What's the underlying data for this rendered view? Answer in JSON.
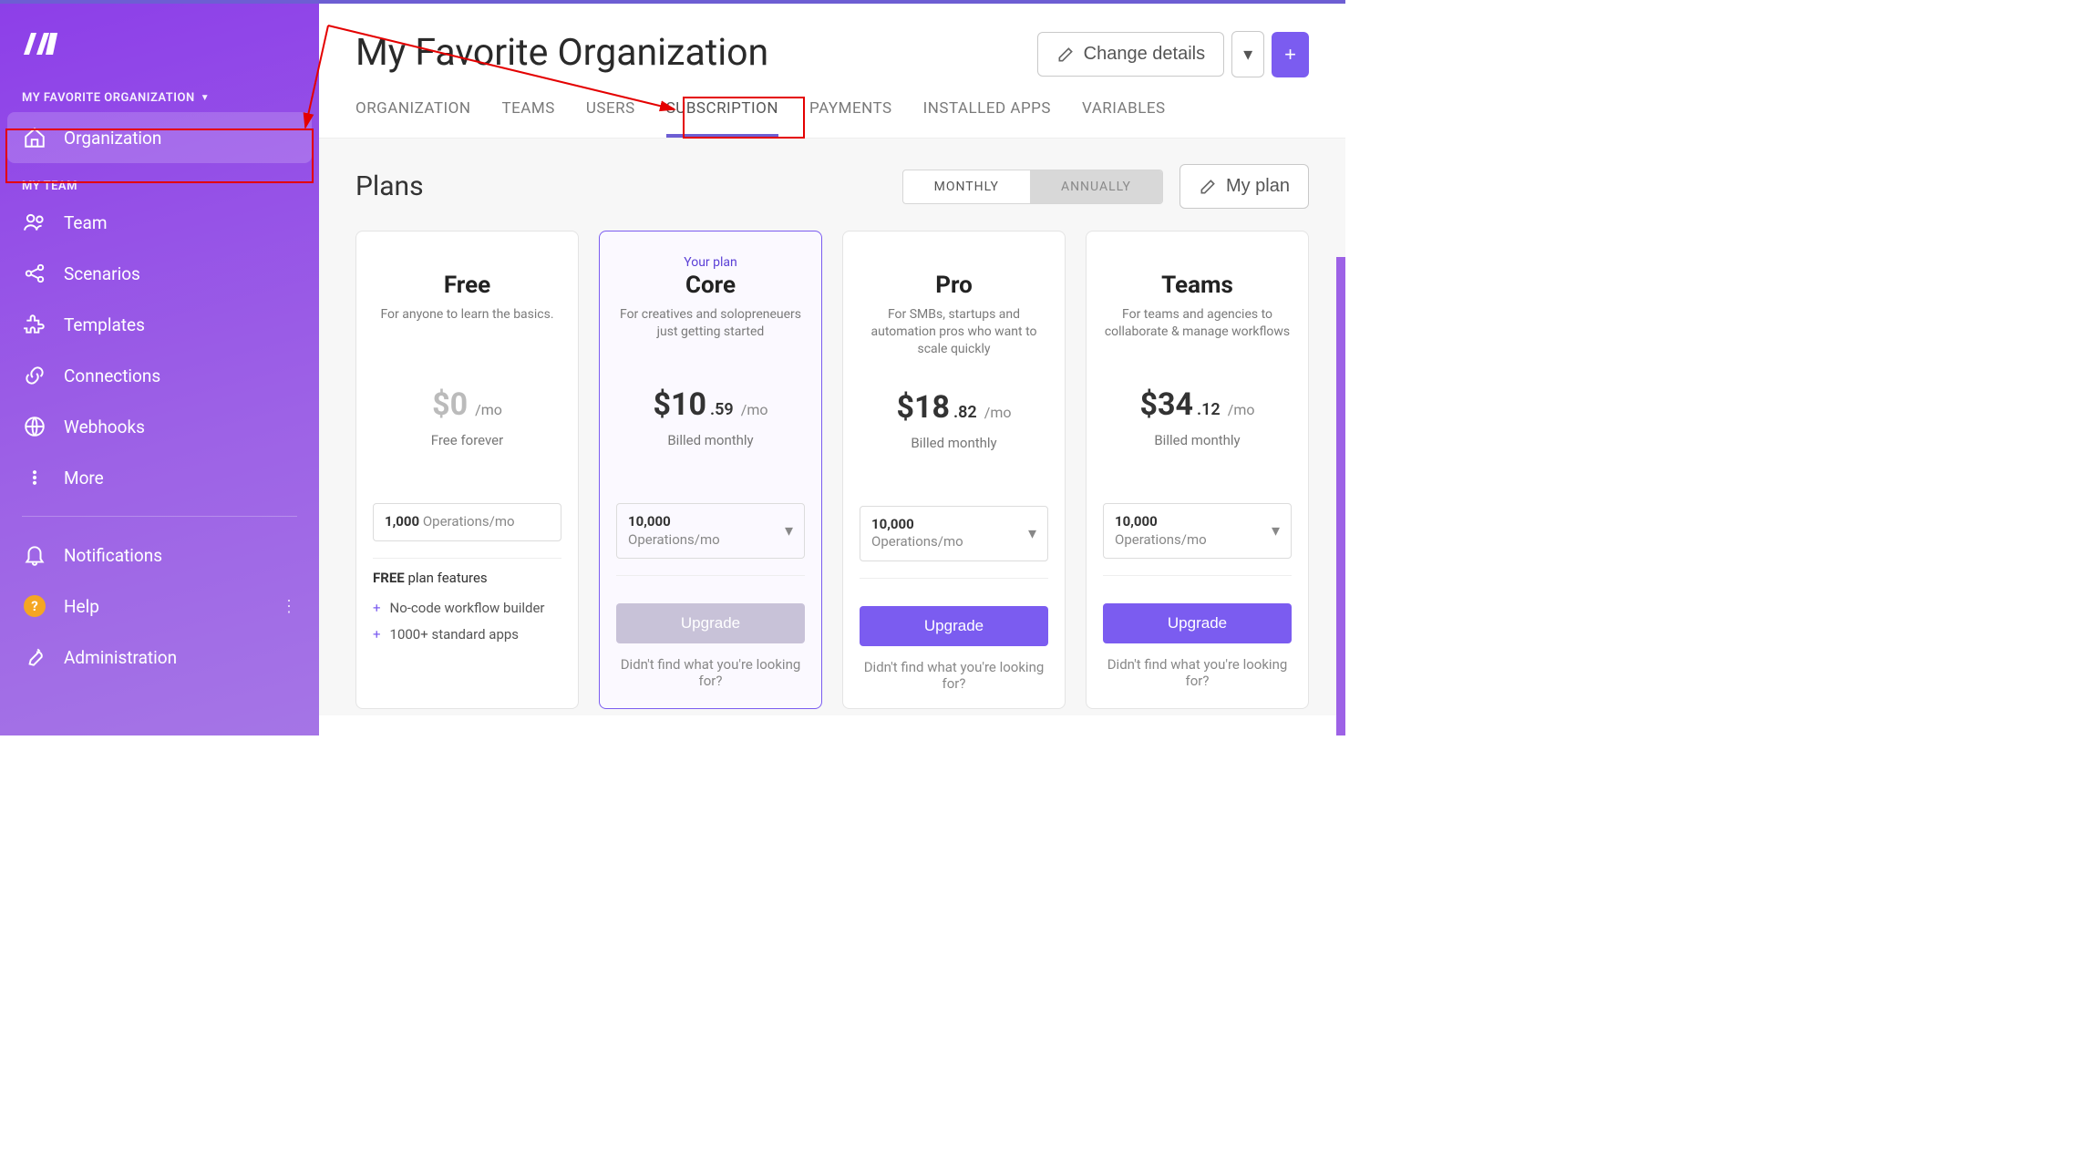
{
  "sidebar": {
    "org_label": "MY FAVORITE ORGANIZATION",
    "org_item": "Organization",
    "team_label": "MY TEAM",
    "items": {
      "team": "Team",
      "scenarios": "Scenarios",
      "templates": "Templates",
      "connections": "Connections",
      "webhooks": "Webhooks",
      "more": "More"
    },
    "footer": {
      "notifications": "Notifications",
      "help": "Help",
      "administration": "Administration"
    }
  },
  "header": {
    "title": "My Favorite Organization",
    "change_details": "Change details"
  },
  "tabs": {
    "organization": "ORGANIZATION",
    "teams": "TEAMS",
    "users": "USERS",
    "subscription": "SUBSCRIPTION",
    "payments": "PAYMENTS",
    "installed": "INSTALLED APPS",
    "variables": "VARIABLES"
  },
  "plans": {
    "title": "Plans",
    "period_monthly": "MONTHLY",
    "period_annually": "ANNUALLY",
    "my_plan": "My plan",
    "your_plan_label": "Your plan",
    "not_found": "Didn't find what you're looking for?",
    "upgrade": "Upgrade",
    "free": {
      "name": "Free",
      "desc": "For anyone to learn the basics.",
      "price_main": "$0",
      "suffix": "/mo",
      "billing": "Free forever",
      "ops_num": "1,000",
      "ops_label": " Operations/mo",
      "features_head_bold": "FREE",
      "features_head_rest": " plan features",
      "feat1": "No-code workflow builder",
      "feat2": "1000+ standard apps"
    },
    "core": {
      "name": "Core",
      "desc": "For creatives and solopreneuers just getting started",
      "price_main": "$10",
      "price_cents": ".59",
      "suffix": "/mo",
      "billing": "Billed monthly",
      "ops_num": "10,000",
      "ops_label": "Operations/mo"
    },
    "pro": {
      "name": "Pro",
      "desc": "For SMBs, startups and automation pros who want to scale quickly",
      "price_main": "$18",
      "price_cents": ".82",
      "suffix": "/mo",
      "billing": "Billed monthly",
      "ops_num": "10,000",
      "ops_label": "Operations/mo"
    },
    "teams": {
      "name": "Teams",
      "desc": "For teams and agencies to collaborate & manage workflows",
      "price_main": "$34",
      "price_cents": ".12",
      "suffix": "/mo",
      "billing": "Billed monthly",
      "ops_num": "10,000",
      "ops_label": "Operations/mo"
    }
  }
}
